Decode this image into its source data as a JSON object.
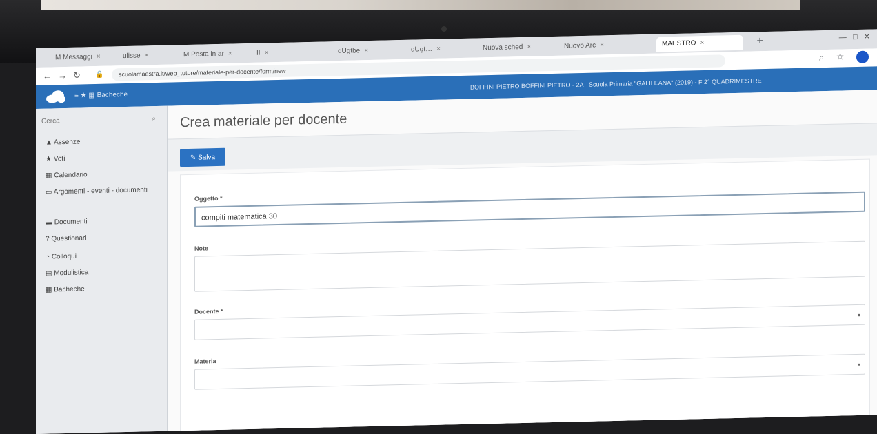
{
  "tabs": [
    {
      "label": "M Messaggi"
    },
    {
      "label": "ulisse"
    },
    {
      "label": "M Posta in ar"
    },
    {
      "label": "II"
    },
    {
      "label": "dUgtbe"
    },
    {
      "label": "dUgt…"
    },
    {
      "label": "Nuova sched"
    },
    {
      "label": "Nuovo Arc"
    },
    {
      "label": "MAESTRO"
    }
  ],
  "address": {
    "url": "scuolamaestra.it/web_tutore/materiale-per-docente/form/new"
  },
  "app": {
    "nav": "≡ ★ ▦ Bacheche",
    "user": "BOFFINI PIETRO BOFFINI PIETRO - 2A - Scuola Primaria \"GALILEANA\" (2019) - F 2° QUADRIMESTRE"
  },
  "sidebar": {
    "search_placeholder": "Cerca",
    "items": [
      {
        "label": "Assenze",
        "icon": "user-icon"
      },
      {
        "label": "Voti",
        "icon": "star-icon"
      },
      {
        "label": "Calendario",
        "icon": "calendar-icon"
      },
      {
        "label": "Argomenti - eventi - documenti",
        "icon": "folder-icon"
      },
      {
        "label": "Documenti",
        "icon": "document-icon"
      },
      {
        "label": "Questionari",
        "icon": "question-icon"
      },
      {
        "label": "Colloqui",
        "icon": "chat-icon"
      },
      {
        "label": "Modulistica",
        "icon": "form-icon"
      },
      {
        "label": "Bacheche",
        "icon": "board-icon"
      }
    ]
  },
  "main": {
    "title": "Crea materiale per docente",
    "save_label": "Salva",
    "fields": {
      "oggetto_label": "Oggetto *",
      "oggetto_value": "compiti matematica 30",
      "note_label": "Note",
      "note_value": "",
      "docente_label": "Docente *",
      "docente_value": "",
      "materia_label": "Materia",
      "materia_value": ""
    }
  }
}
